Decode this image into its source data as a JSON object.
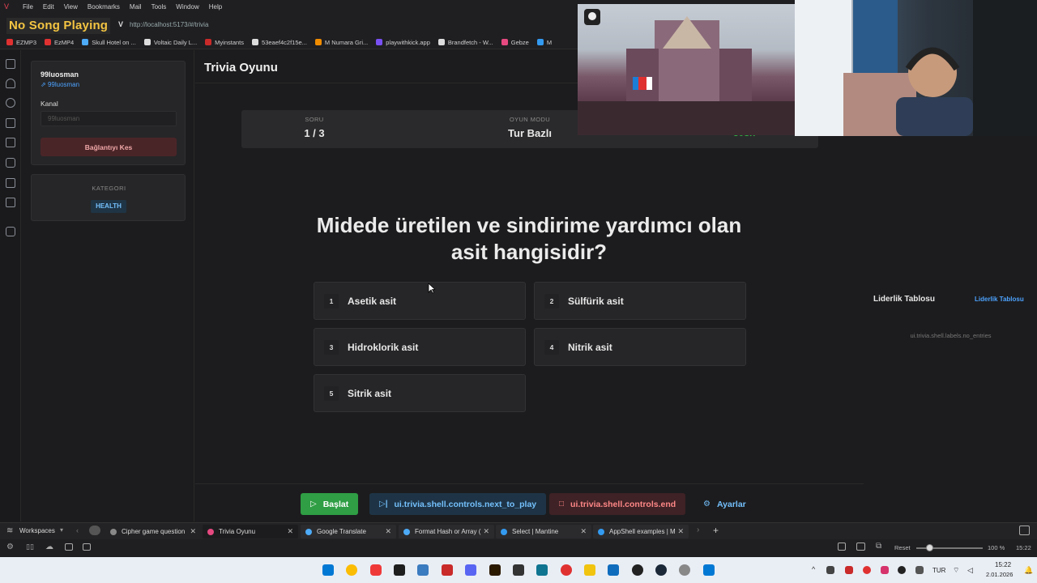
{
  "menubar": {
    "items": [
      "File",
      "Edit",
      "View",
      "Bookmarks",
      "Mail",
      "Tools",
      "Window",
      "Help"
    ]
  },
  "addressbar": {
    "now_playing": "No Song Playing",
    "url_prefix": "V",
    "url": "http://localhost:5173/#/trivia"
  },
  "bookmarks": [
    {
      "label": "EZMP3",
      "color": "#e03131"
    },
    {
      "label": "EzMP4",
      "color": "#e03131"
    },
    {
      "label": "Skull Hotel on ...",
      "color": "#4dabf7"
    },
    {
      "label": "Voltaic Daily L...",
      "color": "#ddd"
    },
    {
      "label": "Myinstants",
      "color": "#c92a2a"
    },
    {
      "label": "53eaef4c2f15e...",
      "color": "#ddd"
    },
    {
      "label": "M Numara Gri...",
      "color": "#f08c00"
    },
    {
      "label": "playwithkick.app",
      "color": "#7950f2"
    },
    {
      "label": "Brandfetch - W...",
      "color": "#ddd"
    },
    {
      "label": "Gebze",
      "color": "#e64980"
    },
    {
      "label": "M",
      "color": "#339af0"
    }
  ],
  "sidebar": {
    "username": "99luosman",
    "user_link": "99luosman",
    "channel_label": "Kanal",
    "channel_placeholder": "99luosman",
    "disconnect_label": "Bağlantıyı Kes",
    "category_label": "KATEGORI",
    "category_value": "HEALTH"
  },
  "main": {
    "title": "Trivia Oyunu",
    "stats": {
      "question_label": "SORU",
      "question_value": "1 / 3",
      "mode_label": "OYUN MODU",
      "mode_value": "Tur Bazlı",
      "extra_value": "30sn"
    },
    "question": "Midede üretilen ve sindirime yardımcı olan asit hangisidir?",
    "options": [
      {
        "num": "1",
        "text": "Asetik asit"
      },
      {
        "num": "2",
        "text": "Sülfürik asit"
      },
      {
        "num": "3",
        "text": "Hidroklorik asit"
      },
      {
        "num": "4",
        "text": "Nitrik asit"
      },
      {
        "num": "5",
        "text": "Sitrik asit"
      }
    ],
    "controls": {
      "start": "Başlat",
      "next": "ui.trivia.shell.controls.next_to_play",
      "end": "ui.trivia.shell.controls.end",
      "settings": "Ayarlar"
    }
  },
  "leaderboard": {
    "title": "Liderlik Tablosu",
    "link": "Liderlik Tablosu",
    "empty": "ui.trivia.shell.labels.no_entries"
  },
  "tabbar": {
    "workspaces": "Workspaces",
    "tabs": [
      {
        "label": "Cipher game question",
        "color": "#aaa"
      },
      {
        "label": "Trivia Oyunu",
        "color": "#e64980"
      },
      {
        "label": "Google Translate",
        "color": "#4dabf7"
      },
      {
        "label": "Format Hash or Array (",
        "color": "#4dabf7"
      },
      {
        "label": "Select | Mantine",
        "color": "#339af0"
      },
      {
        "label": "AppShell examples | M",
        "color": "#339af0"
      }
    ]
  },
  "statusbar": {
    "reset": "Reset",
    "zoom": "100 %",
    "time": "15:22"
  },
  "windows_taskbar": {
    "lang": "TUR",
    "time": "15:22",
    "date": "2.01.2026"
  }
}
